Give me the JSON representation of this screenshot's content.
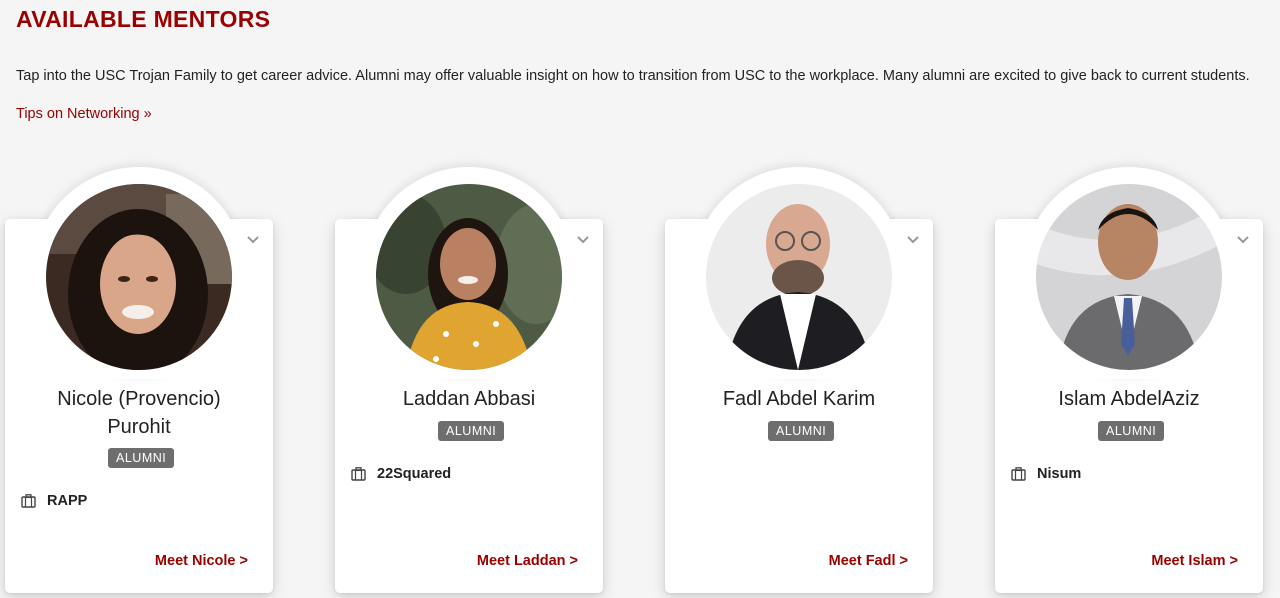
{
  "header": {
    "title": "AVAILABLE MENTORS",
    "intro": "Tap into the USC Trojan Family to get career advice. Alumni may offer valuable insight on how to transition from USC to the workplace. Many alumni are excited to give back to current students.",
    "tips_link": "Tips on Networking »"
  },
  "colors": {
    "brand": "#990000",
    "badge": "#6e6e6e",
    "background": "#f5f5f5"
  },
  "mentors": [
    {
      "name_line1": "Nicole (Provencio)",
      "name_line2": "Purohit",
      "badge": "ALUMNI",
      "company": "RAPP",
      "cta": "Meet Nicole >"
    },
    {
      "name_line1": "Laddan Abbasi",
      "badge": "ALUMNI",
      "company": "22Squared",
      "cta": "Meet Laddan >"
    },
    {
      "name_line1": "Fadl Abdel Karim",
      "badge": "ALUMNI",
      "cta": "Meet Fadl >"
    },
    {
      "name_line1": "Islam AbdelAziz",
      "badge": "ALUMNI",
      "company": "Nisum",
      "cta": "Meet Islam >"
    }
  ]
}
